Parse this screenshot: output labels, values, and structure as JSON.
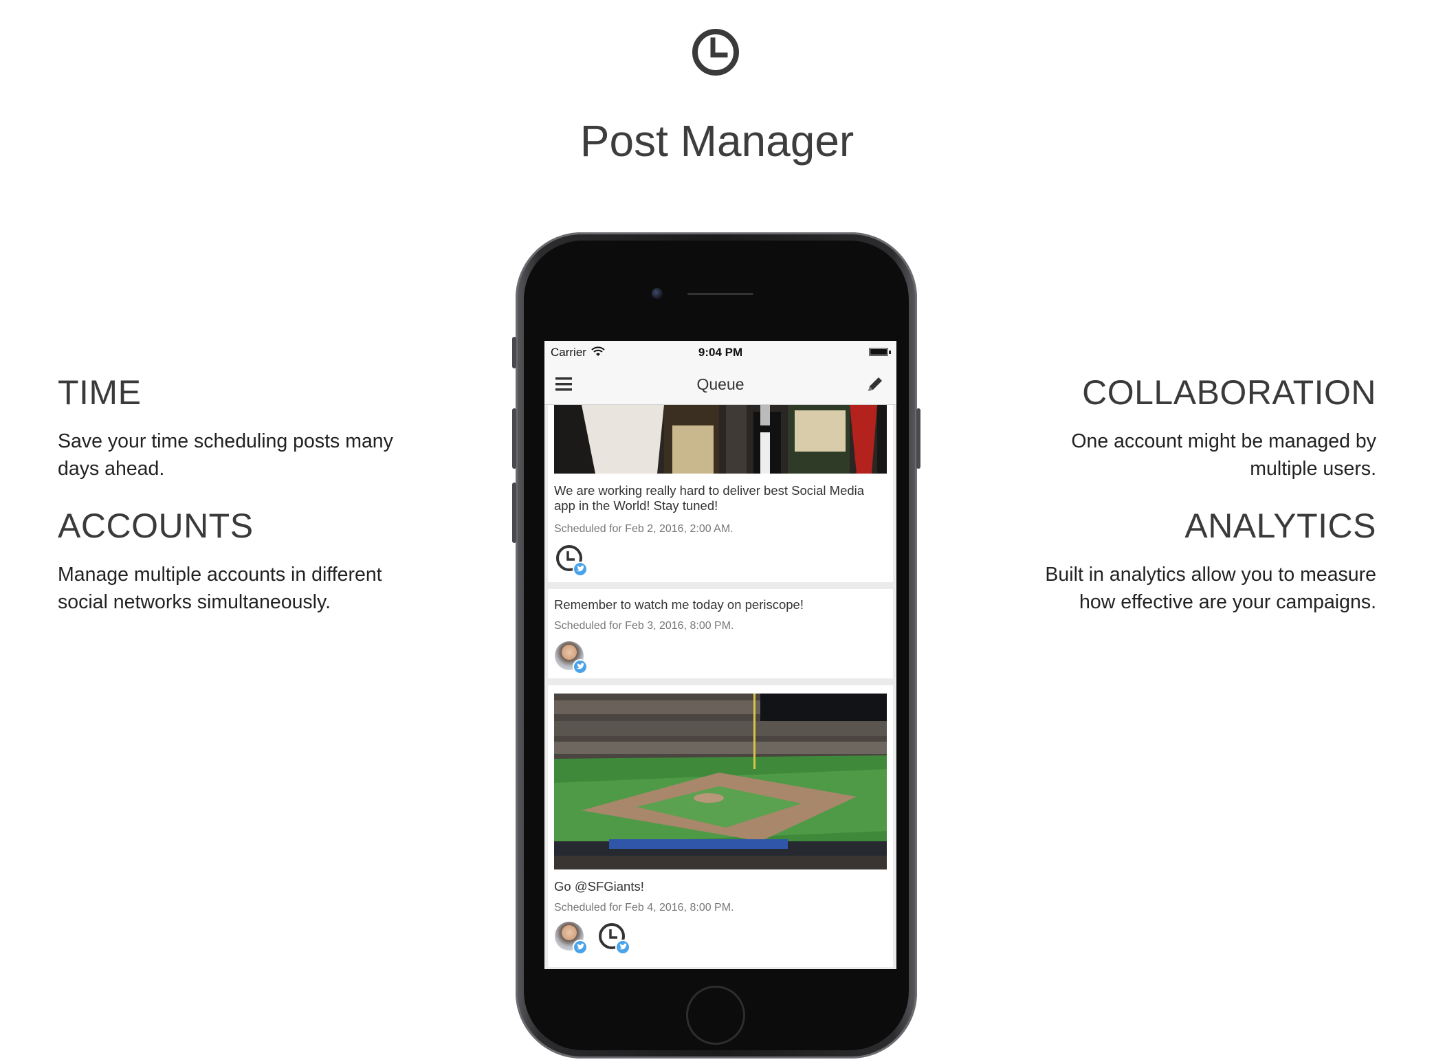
{
  "header": {
    "logo_icon": "clock-icon",
    "title": "Post Manager"
  },
  "features": {
    "time": {
      "title": "TIME",
      "lines": [
        "Save your time scheduling posts many",
        "days ahead."
      ]
    },
    "accounts": {
      "title": "ACCOUNTS",
      "lines": [
        "Manage multiple accounts in different",
        "social networks simultaneously."
      ]
    },
    "collaboration": {
      "title": "COLLABORATION",
      "lines": [
        "One account might be managed by",
        "multiple users."
      ]
    },
    "analytics": {
      "title": "ANALYTICS",
      "lines": [
        "Built in analytics allow you to measure",
        "how effective are your campaigns."
      ]
    }
  },
  "phone": {
    "status": {
      "carrier": "Carrier",
      "time": "9:04 PM"
    },
    "navbar": {
      "title": "Queue",
      "left_icon": "menu-icon",
      "right_icon": "compose-icon"
    },
    "posts": [
      {
        "text": "We are working really hard to deliver best Social Media app in the World! Stay tuned!",
        "scheduled": "Scheduled for Feb 2, 2016, 2:00 AM.",
        "accounts": [
          "clock-avatar"
        ]
      },
      {
        "text": "Remember to watch me today on periscope!",
        "scheduled": "Scheduled for Feb 3, 2016, 8:00 PM.",
        "accounts": [
          "user-avatar"
        ]
      },
      {
        "text": "Go @SFGiants!",
        "scheduled": "Scheduled for Feb 4, 2016, 8:00 PM.",
        "accounts": [
          "user-avatar",
          "clock-avatar"
        ]
      }
    ]
  },
  "colors": {
    "title_text": "#3d3d3d",
    "twitter_badge": "#4aa3e8",
    "phone_body": "#1b1b1c"
  }
}
